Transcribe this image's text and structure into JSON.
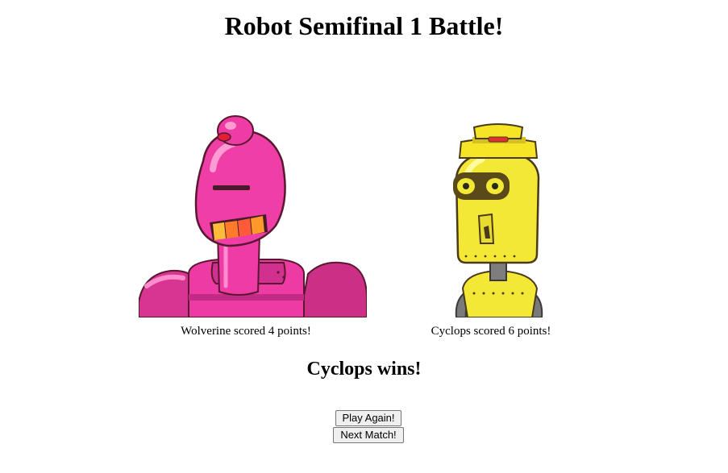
{
  "page": {
    "title": "Robot Semifinal 1 Battle!"
  },
  "robots": [
    {
      "name": "Wolverine",
      "score_text": "Wolverine scored 4 points!",
      "color": "#f03ea7"
    },
    {
      "name": "Cyclops",
      "score_text": "Cyclops scored 6 points!",
      "color": "#f3e836"
    }
  ],
  "result": {
    "winner_text": "Cyclops wins!"
  },
  "buttons": {
    "play_again": "Play Again!",
    "next_match": "Next Match!"
  }
}
